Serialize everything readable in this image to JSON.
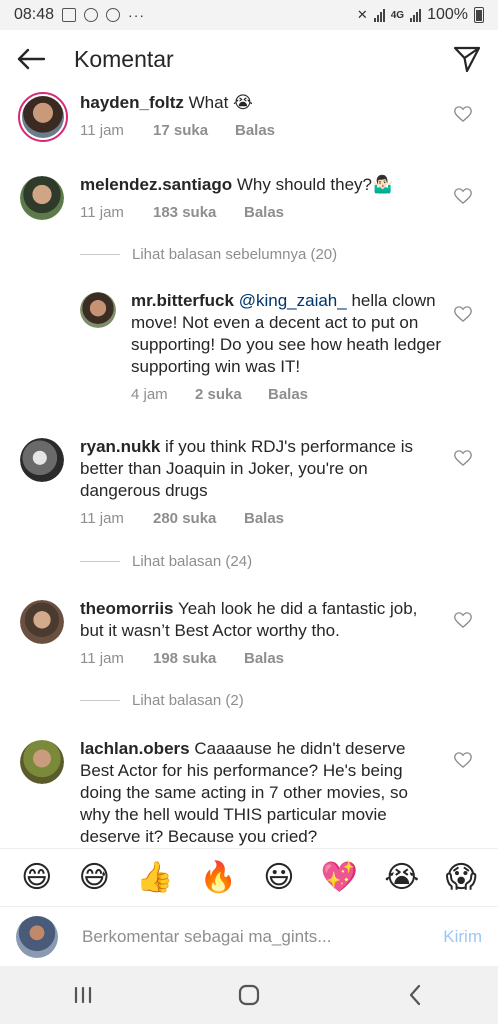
{
  "status_bar": {
    "time": "08:48",
    "overflow": "···",
    "network": "4G",
    "battery": "100%"
  },
  "header": {
    "title": "Komentar"
  },
  "comments": [
    {
      "username": "hayden_foltz",
      "text": "What 😭",
      "time": "11 jam",
      "likes": "17 suka",
      "reply": "Balas"
    },
    {
      "username": "melendez.santiago",
      "text": "Why should they?🤷🏻‍♂️",
      "time": "11 jam",
      "likes": "183 suka",
      "reply": "Balas"
    },
    {
      "username": "ryan.nukk",
      "text": "if you think RDJ's performance is better than Joaquin in Joker, you're on dangerous drugs",
      "time": "11 jam",
      "likes": "280 suka",
      "reply": "Balas"
    },
    {
      "username": "theomorriis",
      "text": "Yeah look he did a fantastic job, but it wasn’t Best Actor worthy tho.",
      "time": "11 jam",
      "likes": "198 suka",
      "reply": "Balas"
    },
    {
      "username": "lachlan.obers",
      "text": "Caaaause he didn't deserve Best Actor for his performance? He's being doing the same acting in 7 other movies, so why the hell would THIS particular movie deserve it? Because you cried?"
    }
  ],
  "replies": {
    "view_previous": "Lihat balasan sebelumnya (20)",
    "reply_comment": {
      "username": "mr.bitterfuck",
      "mention": "@king_zaiah_",
      "text": " hella clown move! Not even a decent act to put on supporting! Do you see how heath ledger supporting win was IT!",
      "time": "4 jam",
      "likes": "2 suka",
      "reply": "Balas"
    },
    "view_ryan": "Lihat balasan (24)",
    "view_theo": "Lihat balasan (2)"
  },
  "emoji_bar": [
    "😄",
    "😅",
    "👍",
    "🔥",
    "😃",
    "💖",
    "😭",
    "😱"
  ],
  "input": {
    "placeholder": "Berkomentar sebagai ma_gints...",
    "post_label": "Kirim"
  },
  "colors": {
    "mention": "#003569",
    "meta_gray": "#8e8e8e",
    "post_disabled": "#9dc6f5",
    "story_ring": "#d62976"
  }
}
